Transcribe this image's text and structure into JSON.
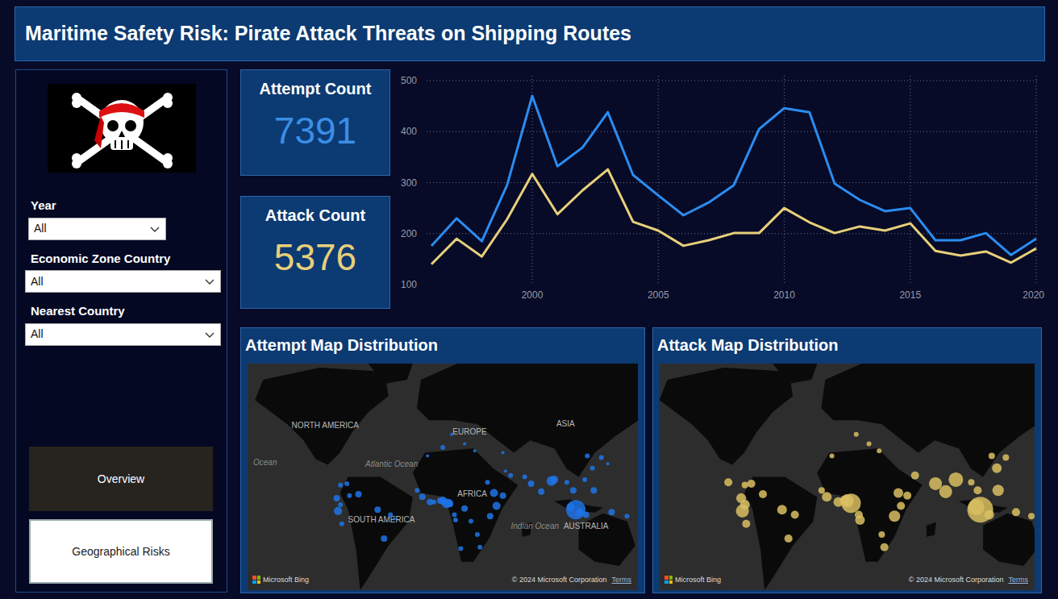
{
  "header": {
    "title": "Maritime Safety Risk: Pirate Attack Threats on Shipping Routes"
  },
  "filters": [
    {
      "label": "Year",
      "value": "All"
    },
    {
      "label": "Economic Zone Country",
      "value": "All"
    },
    {
      "label": "Nearest Country",
      "value": "All"
    }
  ],
  "nav_buttons": [
    {
      "label": "Overview",
      "selected": true
    },
    {
      "label": "Geographical Risks",
      "selected": false
    }
  ],
  "kpis": [
    {
      "label": "Attempt Count",
      "value": "7391",
      "color": "#3a8ee6"
    },
    {
      "label": "Attack Count",
      "value": "5376",
      "color": "#e8cf7a"
    }
  ],
  "chart": {
    "y_ticks": [
      "500",
      "400",
      "300",
      "200",
      "100"
    ],
    "x_ticks": [
      "2000",
      "2005",
      "2010",
      "2015",
      "2020"
    ],
    "x_values": [
      1996,
      1997,
      1998,
      1999,
      2000,
      2001,
      2002,
      2003,
      2004,
      2005,
      2006,
      2007,
      2008,
      2009,
      2010,
      2011,
      2012,
      2013,
      2014,
      2015,
      2016,
      2017,
      2018,
      2019,
      2020
    ],
    "series": [
      {
        "color": "#2b8cf0",
        "values": [
          176,
          230,
          185,
          295,
          470,
          332,
          369,
          438,
          315,
          275,
          236,
          261,
          295,
          405,
          446,
          438,
          298,
          266,
          244,
          250,
          187,
          187,
          201,
          158,
          190
        ]
      },
      {
        "color": "#e8cf7a",
        "values": [
          140,
          190,
          155,
          228,
          317,
          238,
          285,
          326,
          223,
          206,
          176,
          187,
          201,
          201,
          250,
          222,
          201,
          214,
          206,
          220,
          166,
          157,
          165,
          143,
          171
        ]
      }
    ]
  },
  "maps": [
    {
      "title": "Attempt Map Distribution",
      "color": "#1f74e8",
      "labels": [
        {
          "text": "NORTH AMERICA",
          "lon": -89,
          "lat": 53
        },
        {
          "text": "EUROPE",
          "lon": 24,
          "lat": 50
        },
        {
          "text": "ASIA",
          "lon": 99,
          "lat": 54
        },
        {
          "text": "Ocean",
          "lon": -136,
          "lat": 32
        },
        {
          "text": "Atlantic Ocean",
          "lon": -37,
          "lat": 31
        },
        {
          "text": "AFRICA",
          "lon": 26,
          "lat": 9
        },
        {
          "text": "SOUTH AMERICA",
          "lon": -45,
          "lat": -11
        },
        {
          "text": "Indian Ocean",
          "lon": 75,
          "lat": -16
        },
        {
          "text": "AUSTRALIA",
          "lon": 115,
          "lat": -16
        }
      ],
      "points": [
        [
          -77,
          18,
          3
        ],
        [
          -72,
          19,
          3
        ],
        [
          -63,
          11,
          4
        ],
        [
          -70,
          10,
          3
        ],
        [
          -80,
          8,
          4
        ],
        [
          -77,
          3,
          3
        ],
        [
          -79,
          -2,
          5
        ],
        [
          -48,
          -1,
          4
        ],
        [
          -38,
          -5,
          3
        ],
        [
          -43,
          -23,
          4
        ],
        [
          -76,
          -12,
          3
        ],
        [
          -35,
          -8,
          2
        ],
        [
          -17,
          14,
          3
        ],
        [
          -13,
          9,
          4
        ],
        [
          -7,
          5,
          4
        ],
        [
          -4,
          5,
          3
        ],
        [
          1,
          6,
          4
        ],
        [
          3,
          6,
          5
        ],
        [
          6,
          4,
          6
        ],
        [
          8,
          4,
          5
        ],
        [
          9,
          3,
          3
        ],
        [
          12,
          -5,
          3
        ],
        [
          40,
          -6,
          4
        ],
        [
          45,
          2,
          5
        ],
        [
          50,
          10,
          4
        ],
        [
          43,
          12,
          5
        ],
        [
          38,
          20,
          3
        ],
        [
          13,
          -9,
          3
        ],
        [
          20,
          0,
          4
        ],
        [
          25,
          -10,
          3
        ],
        [
          30,
          -20,
          3
        ],
        [
          17,
          -30,
          3
        ],
        [
          32,
          -29,
          3
        ],
        [
          56,
          25,
          3
        ],
        [
          52,
          28,
          2
        ],
        [
          67,
          24,
          3
        ],
        [
          72,
          19,
          4
        ],
        [
          80,
          13,
          4
        ],
        [
          88,
          21,
          6
        ],
        [
          90,
          22,
          5
        ],
        [
          100,
          20,
          3
        ],
        [
          103,
          1,
          5
        ],
        [
          107,
          -1,
          12
        ],
        [
          110,
          -3,
          5
        ],
        [
          115,
          -5,
          4
        ],
        [
          121,
          14,
          4
        ],
        [
          114,
          22,
          3
        ],
        [
          120,
          30,
          3
        ],
        [
          116,
          38,
          3
        ],
        [
          127,
          37,
          3
        ],
        [
          105,
          14,
          4
        ],
        [
          132,
          33,
          2
        ],
        [
          135,
          -3,
          4
        ],
        [
          147,
          -6,
          3
        ],
        [
          160,
          -9,
          2
        ],
        [
          10,
          50,
          2
        ],
        [
          20,
          45,
          2
        ],
        [
          3,
          43,
          3
        ],
        [
          28,
          41,
          2
        ],
        [
          -9,
          38,
          2
        ],
        [
          50,
          40,
          2
        ]
      ],
      "attribution": "Microsoft Bing",
      "copyright": "© 2024 Microsoft Corporation",
      "terms": "Terms"
    },
    {
      "title": "Attack Map Distribution",
      "color": "#d9bf62",
      "labels": [],
      "points": [
        [
          107,
          -1,
          16
        ],
        [
          104,
          1,
          10
        ],
        [
          114,
          -5,
          6
        ],
        [
          121,
          14,
          7
        ],
        [
          88,
          22,
          9
        ],
        [
          80,
          13,
          8
        ],
        [
          72,
          19,
          8
        ],
        [
          56,
          25,
          5
        ],
        [
          43,
          12,
          6
        ],
        [
          50,
          10,
          5
        ],
        [
          45,
          2,
          5
        ],
        [
          40,
          -6,
          7
        ],
        [
          6,
          4,
          12
        ],
        [
          3,
          6,
          8
        ],
        [
          1,
          6,
          6
        ],
        [
          -4,
          5,
          6
        ],
        [
          -13,
          9,
          6
        ],
        [
          -17,
          14,
          4
        ],
        [
          12,
          -5,
          5
        ],
        [
          13,
          -9,
          6
        ],
        [
          32,
          -29,
          5
        ],
        [
          30,
          -20,
          4
        ],
        [
          -79,
          -2,
          8
        ],
        [
          -77,
          3,
          6
        ],
        [
          -80,
          8,
          6
        ],
        [
          -63,
          11,
          5
        ],
        [
          -72,
          19,
          5
        ],
        [
          -77,
          18,
          4
        ],
        [
          -90,
          20,
          5
        ],
        [
          -48,
          -1,
          6
        ],
        [
          -43,
          -23,
          5
        ],
        [
          -38,
          -5,
          5
        ],
        [
          -76,
          -12,
          5
        ],
        [
          120,
          30,
          6
        ],
        [
          116,
          38,
          4
        ],
        [
          127,
          37,
          4
        ],
        [
          105,
          14,
          5
        ],
        [
          135,
          -3,
          5
        ],
        [
          20,
          45,
          3
        ],
        [
          28,
          41,
          3
        ],
        [
          10,
          50,
          3
        ],
        [
          -9,
          38,
          3
        ],
        [
          100,
          20,
          4
        ],
        [
          147,
          -6,
          4
        ],
        [
          160,
          -9,
          4
        ],
        [
          170,
          -15,
          4
        ]
      ],
      "attribution": "Microsoft Bing",
      "copyright": "© 2024 Microsoft Corporation",
      "terms": "Terms"
    }
  ]
}
